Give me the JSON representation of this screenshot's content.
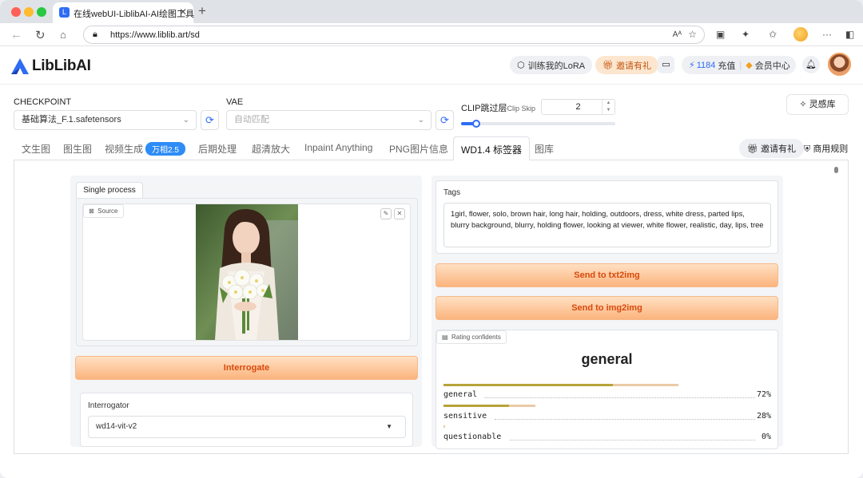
{
  "browser": {
    "tab_title": "在线webUI-LiblibAI-AI绘图工具",
    "tab_favicon_letter": "L",
    "url": "https://www.liblib.art/sd"
  },
  "header": {
    "logo_text": "LibLibAI",
    "train_lora": "训练我的LoRA",
    "invite": "邀请有礼",
    "points": "1184",
    "recharge": "充值",
    "member": "会员中心"
  },
  "controls": {
    "checkpoint_label": "CHECKPOINT",
    "checkpoint_value": "基础算法_F.1.safetensors",
    "vae_label": "VAE",
    "vae_placeholder": "自动匹配",
    "clip_label": "CLIP跳过层",
    "clip_label_en": "Clip Skip",
    "clip_value": "2",
    "clip_slider_fraction": 0.1,
    "inspiration": "灵感库"
  },
  "tabs": [
    {
      "label": "文生图"
    },
    {
      "label": "图生图"
    },
    {
      "label": "视频生成",
      "badge": "万相2.5"
    },
    {
      "label": "后期处理"
    },
    {
      "label": "超清放大"
    },
    {
      "label": "Inpaint Anything"
    },
    {
      "label": "PNG图片信息"
    },
    {
      "label": "WD1.4 标签器",
      "active": true
    },
    {
      "label": "图库"
    }
  ],
  "tab_right": {
    "invite": "邀请有礼",
    "rules": "商用规则"
  },
  "left": {
    "subtab": "Single process",
    "source_label": "Source",
    "interrogate": "Interrogate",
    "interrogator_label": "Interrogator",
    "interrogator_value": "wd14-vit-v2"
  },
  "right": {
    "tags_label": "Tags",
    "tags_value": "1girl, flower, solo, brown hair, long hair, holding, outdoors, dress, white dress, parted lips, blurry background, blurry, holding flower, looking at viewer, white flower, realistic, day, lips, tree",
    "send_txt2img": "Send to txt2img",
    "send_img2img": "Send to img2img",
    "rating_chip": "Rating confidents",
    "rating_title": "general",
    "ratings": [
      {
        "name": "general",
        "pct": "72%",
        "value": 0.72
      },
      {
        "name": "sensitive",
        "pct": "28%",
        "value": 0.28
      },
      {
        "name": "questionable",
        "pct": "0%",
        "value": 0.0
      }
    ]
  },
  "colors": {
    "accent": "#2e6cf6",
    "orange": "#d94a0c",
    "bar_gold": "#b8a33a",
    "bar_light": "#eacba7"
  }
}
